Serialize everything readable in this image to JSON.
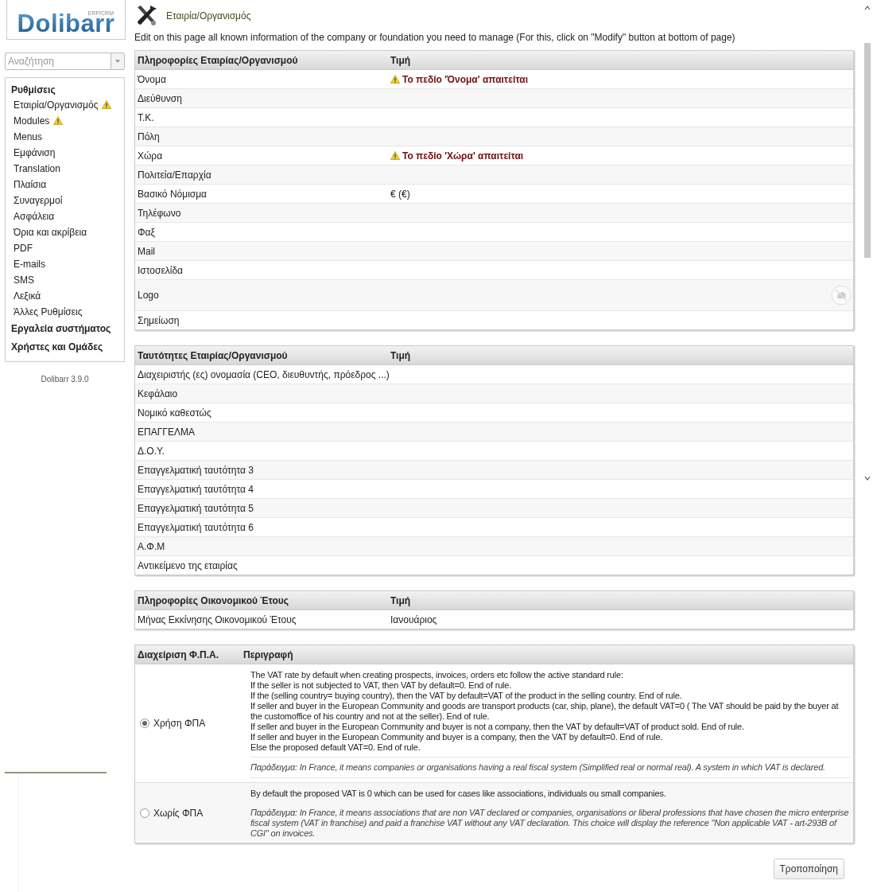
{
  "logo": {
    "text": "Dolibarr",
    "subtext": "ERP/CRM"
  },
  "search": {
    "placeholder": "Αναζήτηση"
  },
  "menu": [
    {
      "label": "Ρυθμίσεις",
      "children": [
        {
          "label": "Εταιρία/Οργανισμός",
          "warning": true
        },
        {
          "label": "Modules",
          "warning": true
        },
        {
          "label": "Menus",
          "warning": false
        },
        {
          "label": "Εμφάνιση",
          "warning": false
        },
        {
          "label": "Translation",
          "warning": false
        },
        {
          "label": "Πλαίσια",
          "warning": false
        },
        {
          "label": "Συναγερμοί",
          "warning": false
        },
        {
          "label": "Ασφάλεια",
          "warning": false
        },
        {
          "label": "Όρια και ακρίβεια",
          "warning": false
        },
        {
          "label": "PDF",
          "warning": false
        },
        {
          "label": "E-mails",
          "warning": false
        },
        {
          "label": "SMS",
          "warning": false
        },
        {
          "label": "Λεξικά",
          "warning": false
        },
        {
          "label": "Άλλες Ρυθμίσεις",
          "warning": false
        }
      ]
    },
    {
      "label": "Εργαλεία συστήματος"
    },
    {
      "label": "Χρήστες και Ομάδες"
    }
  ],
  "version": "Dolibarr 3.9.0",
  "page": {
    "title": "Εταιρία/Οργανισμός",
    "description": "Edit on this page all known information of the company or foundation you need to manage (For this, click on \"Modify\" button at bottom of page)"
  },
  "tables": [
    {
      "columns": [
        "Πληροφορίες Εταιρίας/Οργανισμού",
        "Τιμή"
      ],
      "rows": [
        {
          "label": "Όνομα",
          "kind": "warning",
          "value": "Το πεδίο 'Όνομα' απαιτείται"
        },
        {
          "label": "Διεύθυνση",
          "kind": "text"
        },
        {
          "label": "Τ.Κ.",
          "kind": "text"
        },
        {
          "label": "Πόλη",
          "kind": "text"
        },
        {
          "label": "Χώρα",
          "kind": "warning",
          "value": "Το πεδίο 'Χώρα' απαιτείται"
        },
        {
          "label": "Πολιτεία/Επαρχία",
          "kind": "text"
        },
        {
          "label": "Βασικό Νόμισμα",
          "kind": "text",
          "value": "€ (€)"
        },
        {
          "label": "Τηλέφωνο",
          "kind": "text"
        },
        {
          "label": "Φαξ",
          "kind": "text"
        },
        {
          "label": "Mail",
          "kind": "text"
        },
        {
          "label": "Ιστοσελίδα",
          "kind": "text"
        },
        {
          "label": "Logo",
          "kind": "logo"
        },
        {
          "label": "Σημείωση",
          "kind": "text"
        }
      ]
    },
    {
      "columns": [
        "Ταυτότητες Εταιρίας/Οργανισμού",
        "Τιμή"
      ],
      "rows": [
        {
          "label": "Διαχειριστής (ες) ονομασία (CEO, διευθυντής, πρόεδρος ...)",
          "kind": "text"
        },
        {
          "label": "Κεφάλαιο",
          "kind": "text"
        },
        {
          "label": "Νομικό καθεστώς",
          "kind": "text"
        },
        {
          "label": "ΕΠΑΓΓΕΛΜΑ",
          "kind": "text"
        },
        {
          "label": "Δ.Ο.Υ.",
          "kind": "text"
        },
        {
          "label": "Επαγγελματική ταυτότητα 3",
          "kind": "text"
        },
        {
          "label": "Επαγγελματική ταυτότητα 4",
          "kind": "text"
        },
        {
          "label": "Επαγγελματική ταυτότητα 5",
          "kind": "text"
        },
        {
          "label": "Επαγγελματική ταυτότητα 6",
          "kind": "text"
        },
        {
          "label": "Α.Φ.Μ",
          "kind": "text"
        },
        {
          "label": "Αντικείμενο της εταιρίας",
          "kind": "text"
        }
      ]
    },
    {
      "columns": [
        "Πληροφορίες Οικονομικού Έτους",
        "Τιμή"
      ],
      "rows": [
        {
          "label": "Μήνας Εκκίνησης Οικονομικού Έτους",
          "kind": "text",
          "value": "Ιανουάριος"
        }
      ]
    }
  ],
  "vat": {
    "columns": [
      "Διαχείριση Φ.Π.Α.",
      "Περιγραφή"
    ],
    "options": [
      {
        "label": "Χρήση ΦΠΑ",
        "selected": true,
        "lines": [
          "The VAT rate by default when creating prospects, invoices, orders etc follow the active standard rule:",
          "If the seller is not subjected to VAT, then VAT by default=0. End of rule.",
          "If the (selling country= buying country), then the VAT by default=VAT of the product in the selling country. End of rule.",
          "If seller and buyer in the European Community and goods are transport products (car, ship, plane), the default VAT=0 ( The VAT should be paid by the buyer at the customoffice of his country and not at the seller). End of rule.",
          "If seller and buyer in the European Community and buyer is not a company, then the VAT by default=VAT of product sold. End of rule.",
          "If seller and buyer in the European Community and buyer is a company, then the VAT by default=0. End of rule.",
          "Else the proposed default VAT=0. End of rule."
        ],
        "example": "Παράδειγμα: In France, it means companies or organisations having a real fiscal system (Simplified real or normal real). A system in which VAT is declared."
      },
      {
        "label": "Χωρίς ΦΠΑ",
        "selected": false,
        "lines": [
          "By default the proposed VAT is 0 which can be used for cases like associations, individuals ou small companies."
        ],
        "example": "Παράδειγμα: In France, it means associations that are non VAT declared or companies, organisations or liberal professions that have chosen the micro enterprise fiscal system (VAT in franchise) and paid a franchise VAT without any VAT declaration. This choice will display the reference \"Non applicable VAT - art-293B of CGI\" on invoices."
      }
    ]
  },
  "modify_button": "Τροποποίηση"
}
